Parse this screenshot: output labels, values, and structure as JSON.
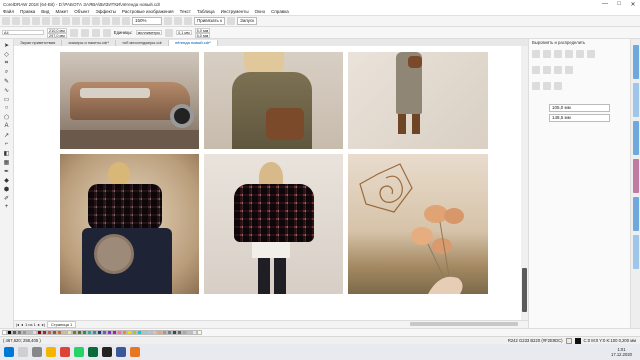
{
  "window": {
    "title": "CorelDRAW 2018 (64-Bit) - D:\\РАБОТА ЗАЯВА\\ВИЗИТКИ\\лёгенда новый.cdr",
    "controls": [
      "—",
      "□",
      "✕"
    ]
  },
  "menu": [
    "Файл",
    "Правка",
    "Вид",
    "Макет",
    "Объект",
    "Эффекты",
    "Растровые изображения",
    "Текст",
    "Таблица",
    "Инструменты",
    "Окно",
    "Справка"
  ],
  "toolbar": {
    "zoom": "150%",
    "snap": "Привязать к",
    "launch": "Запуск"
  },
  "propbar": {
    "page_size": "A4",
    "width": "210,0 мм",
    "height": "297,0 мм",
    "units_label": "Единицы:",
    "units": "миллиметры",
    "nudge": "0,1 мм",
    "dup_x": "5,0 мм",
    "dup_y": "5,0 мм"
  },
  "tabs": [
    "Экран приветствия",
    "хоккеры и пакеты.cdr*",
    "тоб мессенджеры.cdr",
    "лёгенда новый.cdr*"
  ],
  "dock": {
    "title": "Выровнять и распределить",
    "field1": "105,0 мм",
    "field2": "148,5 мм"
  },
  "page_nav": {
    "label": "Страница 1",
    "of": "1 из 1"
  },
  "status": {
    "coords": "( 467,620; 258,405 )",
    "color_info": "R242 G233 B220 (#F2E9DC)",
    "outline": "C:0 M:0 Y:0 K:100  0,200 мм"
  },
  "clock": {
    "time": "1:01",
    "date": "17.12.2020"
  },
  "colors": {
    "accent": "#0078d7",
    "canvas": "#ffffff",
    "scroll": "#5a5a5a"
  },
  "photos": [
    "car",
    "brown-dress-bag",
    "wall-dress",
    "plaid-poncho-hat",
    "plaid-poncho-back",
    "spiral-flowers"
  ]
}
